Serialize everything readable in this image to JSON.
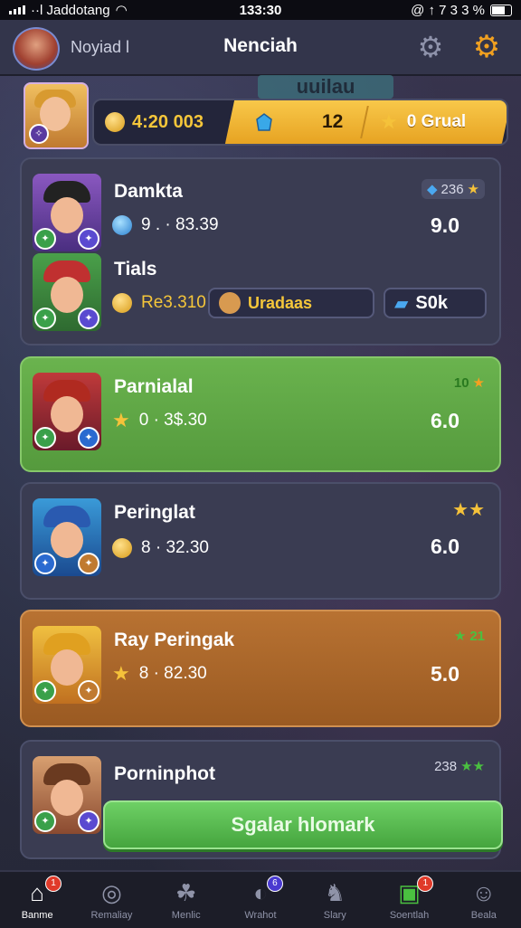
{
  "status_bar": {
    "carrier": "··l Jaddotang",
    "time": "133:30",
    "right": "@ ↑ 7 3 3 %"
  },
  "header": {
    "player_name": "Noyiad l",
    "title": "Nenciah",
    "banner_text": "uuilau"
  },
  "currency": {
    "gold": "4:20 003",
    "gems": "12",
    "stars": "0 Grual"
  },
  "cards": [
    {
      "name": "Damkta",
      "stat": "9 . · 83.39",
      "score": "9.0",
      "corner": "236",
      "name2": "Tials",
      "stat2": "Re3.310",
      "chip_label": "Uradaas",
      "chip2_label": "S0k"
    },
    {
      "name": "Parnialal",
      "stat": "0 · 3$.30",
      "score": "6.0",
      "corner": "10"
    },
    {
      "name": "Peringlat",
      "stat": "8 · 32.30",
      "score": "6.0"
    },
    {
      "name": "Ray Peringak",
      "stat": "8 · 82.30",
      "score": "5.0",
      "corner": "21"
    },
    {
      "name": "Porninphot",
      "corner": "238"
    }
  ],
  "cta_label": "Sgalar hlomark",
  "nav": [
    {
      "label": "Banme",
      "badge": "1"
    },
    {
      "label": "Remaliay"
    },
    {
      "label": "Menlic"
    },
    {
      "label": "Wrahot",
      "badge": "6"
    },
    {
      "label": "Slary"
    },
    {
      "label": "Soentlah",
      "badge": "1"
    },
    {
      "label": "Beala"
    }
  ],
  "colors": {
    "accent_gold": "#f5c63a",
    "card_green": "#6ab34e",
    "card_orange": "#b87232",
    "cta_green": "#5cc053"
  }
}
